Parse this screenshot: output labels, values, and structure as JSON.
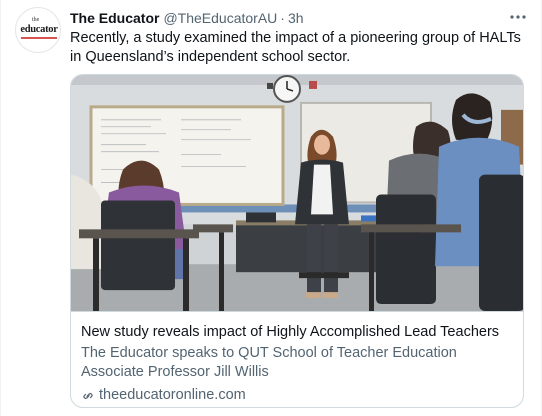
{
  "author": {
    "display_name": "The Educator",
    "handle": "@TheEducatorAU",
    "separator": "·",
    "timestamp": "3h",
    "avatar_logo": {
      "small_text": "the",
      "word": "educator"
    }
  },
  "tweet": {
    "text": "Recently, a study examined the impact of a pioneering group of HALTs in Queensland’s independent school sector."
  },
  "link_card": {
    "title": "New study reveals impact of Highly Accomplished Lead Teachers",
    "description": "The Educator speaks to QUT School of Teacher Education Associate Professor Jill Willis",
    "domain": "theeducatoronline.com",
    "image_icon": "classroom-photo"
  },
  "icons": {
    "more": "more-options-icon",
    "link": "link-icon"
  },
  "colors": {
    "text_primary": "#0f1419",
    "text_secondary": "#536471",
    "border": "#cfd9de",
    "logo_accent": "#d9534f"
  }
}
